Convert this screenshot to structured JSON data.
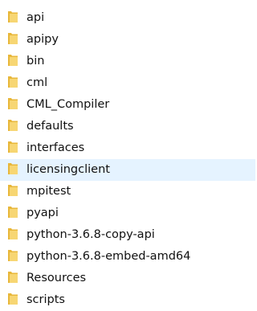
{
  "folder_color": "#e8b73a",
  "folder_color_light": "#f7d673",
  "hover_color": "#e5f3ff",
  "items": [
    {
      "name": "api",
      "icon": "folder-icon"
    },
    {
      "name": "apipy",
      "icon": "folder-icon"
    },
    {
      "name": "bin",
      "icon": "folder-icon"
    },
    {
      "name": "cml",
      "icon": "folder-icon"
    },
    {
      "name": "CML_Compiler",
      "icon": "folder-icon"
    },
    {
      "name": "defaults",
      "icon": "folder-icon"
    },
    {
      "name": "interfaces",
      "icon": "folder-icon"
    },
    {
      "name": "licensingclient",
      "icon": "folder-icon",
      "hovered": true
    },
    {
      "name": "mpitest",
      "icon": "folder-icon"
    },
    {
      "name": "pyapi",
      "icon": "folder-icon"
    },
    {
      "name": "python-3.6.8-copy-api",
      "icon": "folder-icon"
    },
    {
      "name": "python-3.6.8-embed-amd64",
      "icon": "folder-icon"
    },
    {
      "name": "Resources",
      "icon": "folder-icon"
    },
    {
      "name": "scripts",
      "icon": "folder-icon"
    }
  ]
}
